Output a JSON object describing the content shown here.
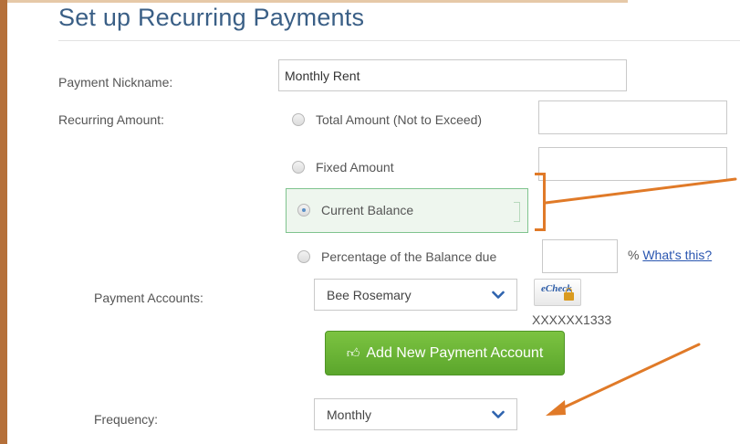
{
  "page": {
    "title": "Set up Recurring Payments"
  },
  "form": {
    "nickname": {
      "label": "Payment Nickname:",
      "value": "Monthly Rent"
    },
    "amount": {
      "label": "Recurring Amount:",
      "options": [
        {
          "label": "Total Amount (Not to Exceed)",
          "selected": false
        },
        {
          "label": "Fixed Amount",
          "selected": false
        },
        {
          "label": "Current Balance",
          "selected": true
        },
        {
          "label": "Percentage of the Balance due",
          "selected": false
        }
      ],
      "percent_suffix": "%",
      "help_link": "What's this?"
    },
    "accounts": {
      "label": "Payment Accounts:",
      "selected": "Bee Rosemary",
      "badge_text": "eCheck",
      "account_number": "XXXXXX1333"
    },
    "add_account_button": "Add New Payment Account",
    "frequency": {
      "label": "Frequency:",
      "selected": "Monthly"
    }
  },
  "colors": {
    "title": "#3a5f86",
    "annotation": "#e07a28",
    "button_green": "#5ba62c",
    "link": "#2a56b0",
    "highlight_border": "#7fc48e"
  },
  "icons": {
    "radio": "radio-button-icon",
    "dropdown": "chevron-down-icon",
    "add": "thumbs-up-icon",
    "echeck": "echeck-logo-icon"
  }
}
